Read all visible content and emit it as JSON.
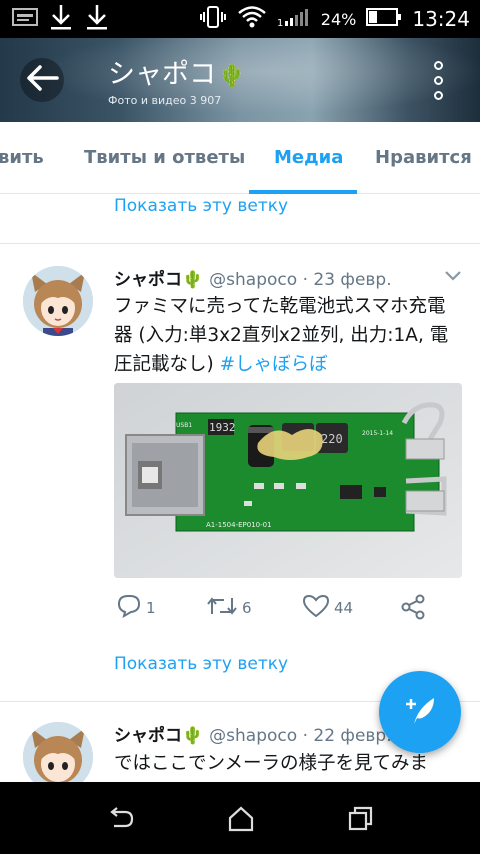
{
  "status_bar": {
    "battery_percent": "24%",
    "time": "13:24",
    "icons": [
      "image-icon",
      "download-icon",
      "download-icon",
      "vibrate-icon",
      "wifi-icon",
      "signal-icon",
      "battery-icon"
    ]
  },
  "header": {
    "title": "シャポコ",
    "title_emoji": "🌵",
    "subtitle": "Фото и видео 3 907",
    "back_icon": "arrow-left-icon",
    "more_icon": "more-vertical-icon"
  },
  "tabs": [
    {
      "label": "вить"
    },
    {
      "label": "Твиты и ответы"
    },
    {
      "label": "Медиа",
      "active": true
    },
    {
      "label": "Нравится"
    }
  ],
  "feed": {
    "show_thread_top": "Показать эту ветку",
    "tweet1": {
      "name": "シャポコ",
      "emoji": "🌵",
      "handle": "@shapoco · 23 февр.",
      "text": "ファミマに売ってた乾電池式スマホ充電器 (入力:単3x2直列x2並列, 出力:1A, 電圧記載なし) ",
      "hashtag": "#しゃぼらぼ",
      "actions": {
        "replies": "1",
        "retweets": "6",
        "likes": "44"
      },
      "show_thread": "Показать эту ветку"
    },
    "tweet2": {
      "name": "シャポコ",
      "emoji": "🌵",
      "handle": "@shapoco · 22 февр.",
      "text": "ではここでンメーラの様子を見てみま"
    }
  },
  "media_labels": {
    "ic": "1932",
    "coil": "220",
    "pcb_text": "A1-1504-EP010-01",
    "date": "2015-1-14",
    "usb": "USB1"
  },
  "colors": {
    "accent": "#1da1f2",
    "text": "#14171a",
    "secondary": "#657786",
    "divider": "#e1e8ed"
  }
}
